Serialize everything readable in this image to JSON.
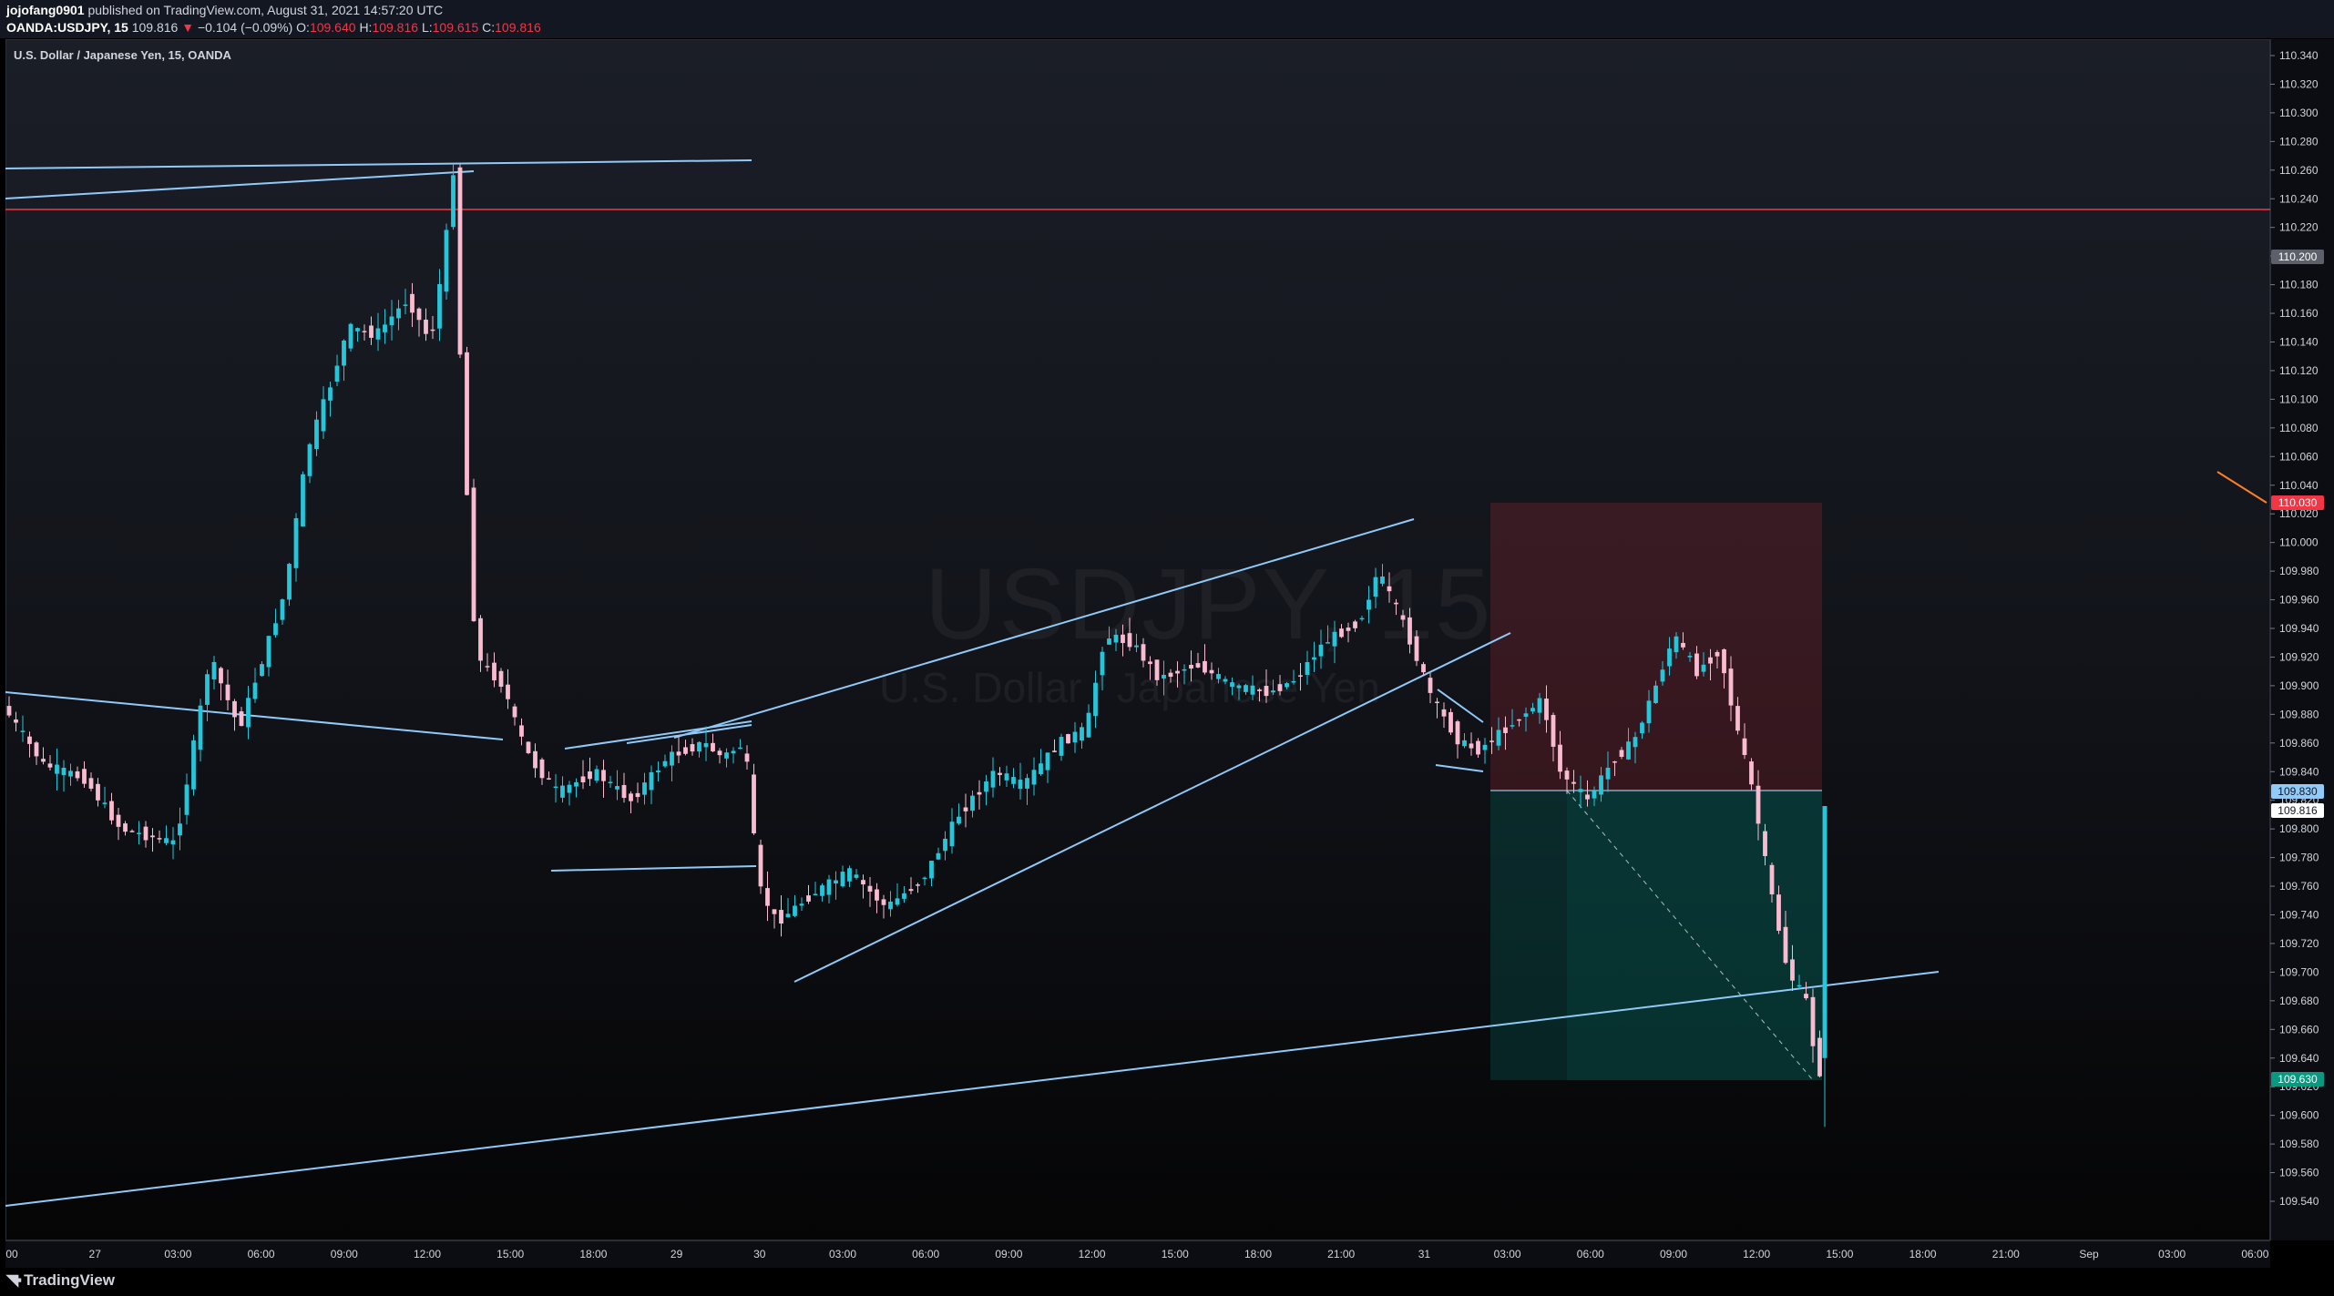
{
  "header": {
    "publisher": "jojofang0901",
    "published_text": "published on TradingView.com, August 31, 2021 14:57:20 UTC",
    "symbol": "OANDA:USDJPY, 15",
    "last": "109.816",
    "change_arrow": "▼",
    "change": "−0.104 (−0.09%)",
    "o_label": "O:",
    "o_value": "109.640",
    "h_label": "H:",
    "h_value": "109.816",
    "l_label": "L:",
    "l_value": "109.615",
    "c_label": "C:",
    "c_value": "109.816"
  },
  "pane_title": "U.S. Dollar / Japanese Yen, 15, OANDA",
  "watermark": {
    "symbol": "USDJPY, 15",
    "name": "U.S. Dollar / Japanese Yen"
  },
  "price_axis": {
    "ticks": [
      "110.340",
      "110.320",
      "110.300",
      "110.280",
      "110.260",
      "110.240",
      "110.220",
      "110.200",
      "110.180",
      "110.160",
      "110.140",
      "110.120",
      "110.100",
      "110.080",
      "110.060",
      "110.040",
      "110.020",
      "110.000",
      "109.980",
      "109.960",
      "109.940",
      "109.920",
      "109.900",
      "109.880",
      "109.860",
      "109.840",
      "109.820",
      "109.800",
      "109.780",
      "109.760",
      "109.740",
      "109.720",
      "109.700",
      "109.680",
      "109.660",
      "109.640",
      "109.620",
      "109.600",
      "109.580",
      "109.560",
      "109.540"
    ],
    "badges": {
      "crosshair": "110.200",
      "target": "110.030",
      "entry": "109.830",
      "last": "109.816",
      "stop": "109.630"
    }
  },
  "time_axis": {
    "labels": [
      "00",
      "27",
      "03:00",
      "06:00",
      "09:00",
      "12:00",
      "15:00",
      "18:00",
      "29",
      "30",
      "03:00",
      "06:00",
      "09:00",
      "12:00",
      "15:00",
      "18:00",
      "21:00",
      "31",
      "03:00",
      "06:00",
      "09:00",
      "12:00",
      "15:00",
      "18:00",
      "21:00",
      "Sep",
      "03:00",
      "06:00"
    ]
  },
  "footer": {
    "logo_text": "TradingView"
  },
  "colors": {
    "up": "#26c6da",
    "down": "#f8bbd0",
    "trendline": "#90caf9",
    "resistance": "#f23645",
    "profit_zone": "rgba(0,137,123,0.25)",
    "loss_zone": "rgba(242,54,69,0.18)"
  }
}
